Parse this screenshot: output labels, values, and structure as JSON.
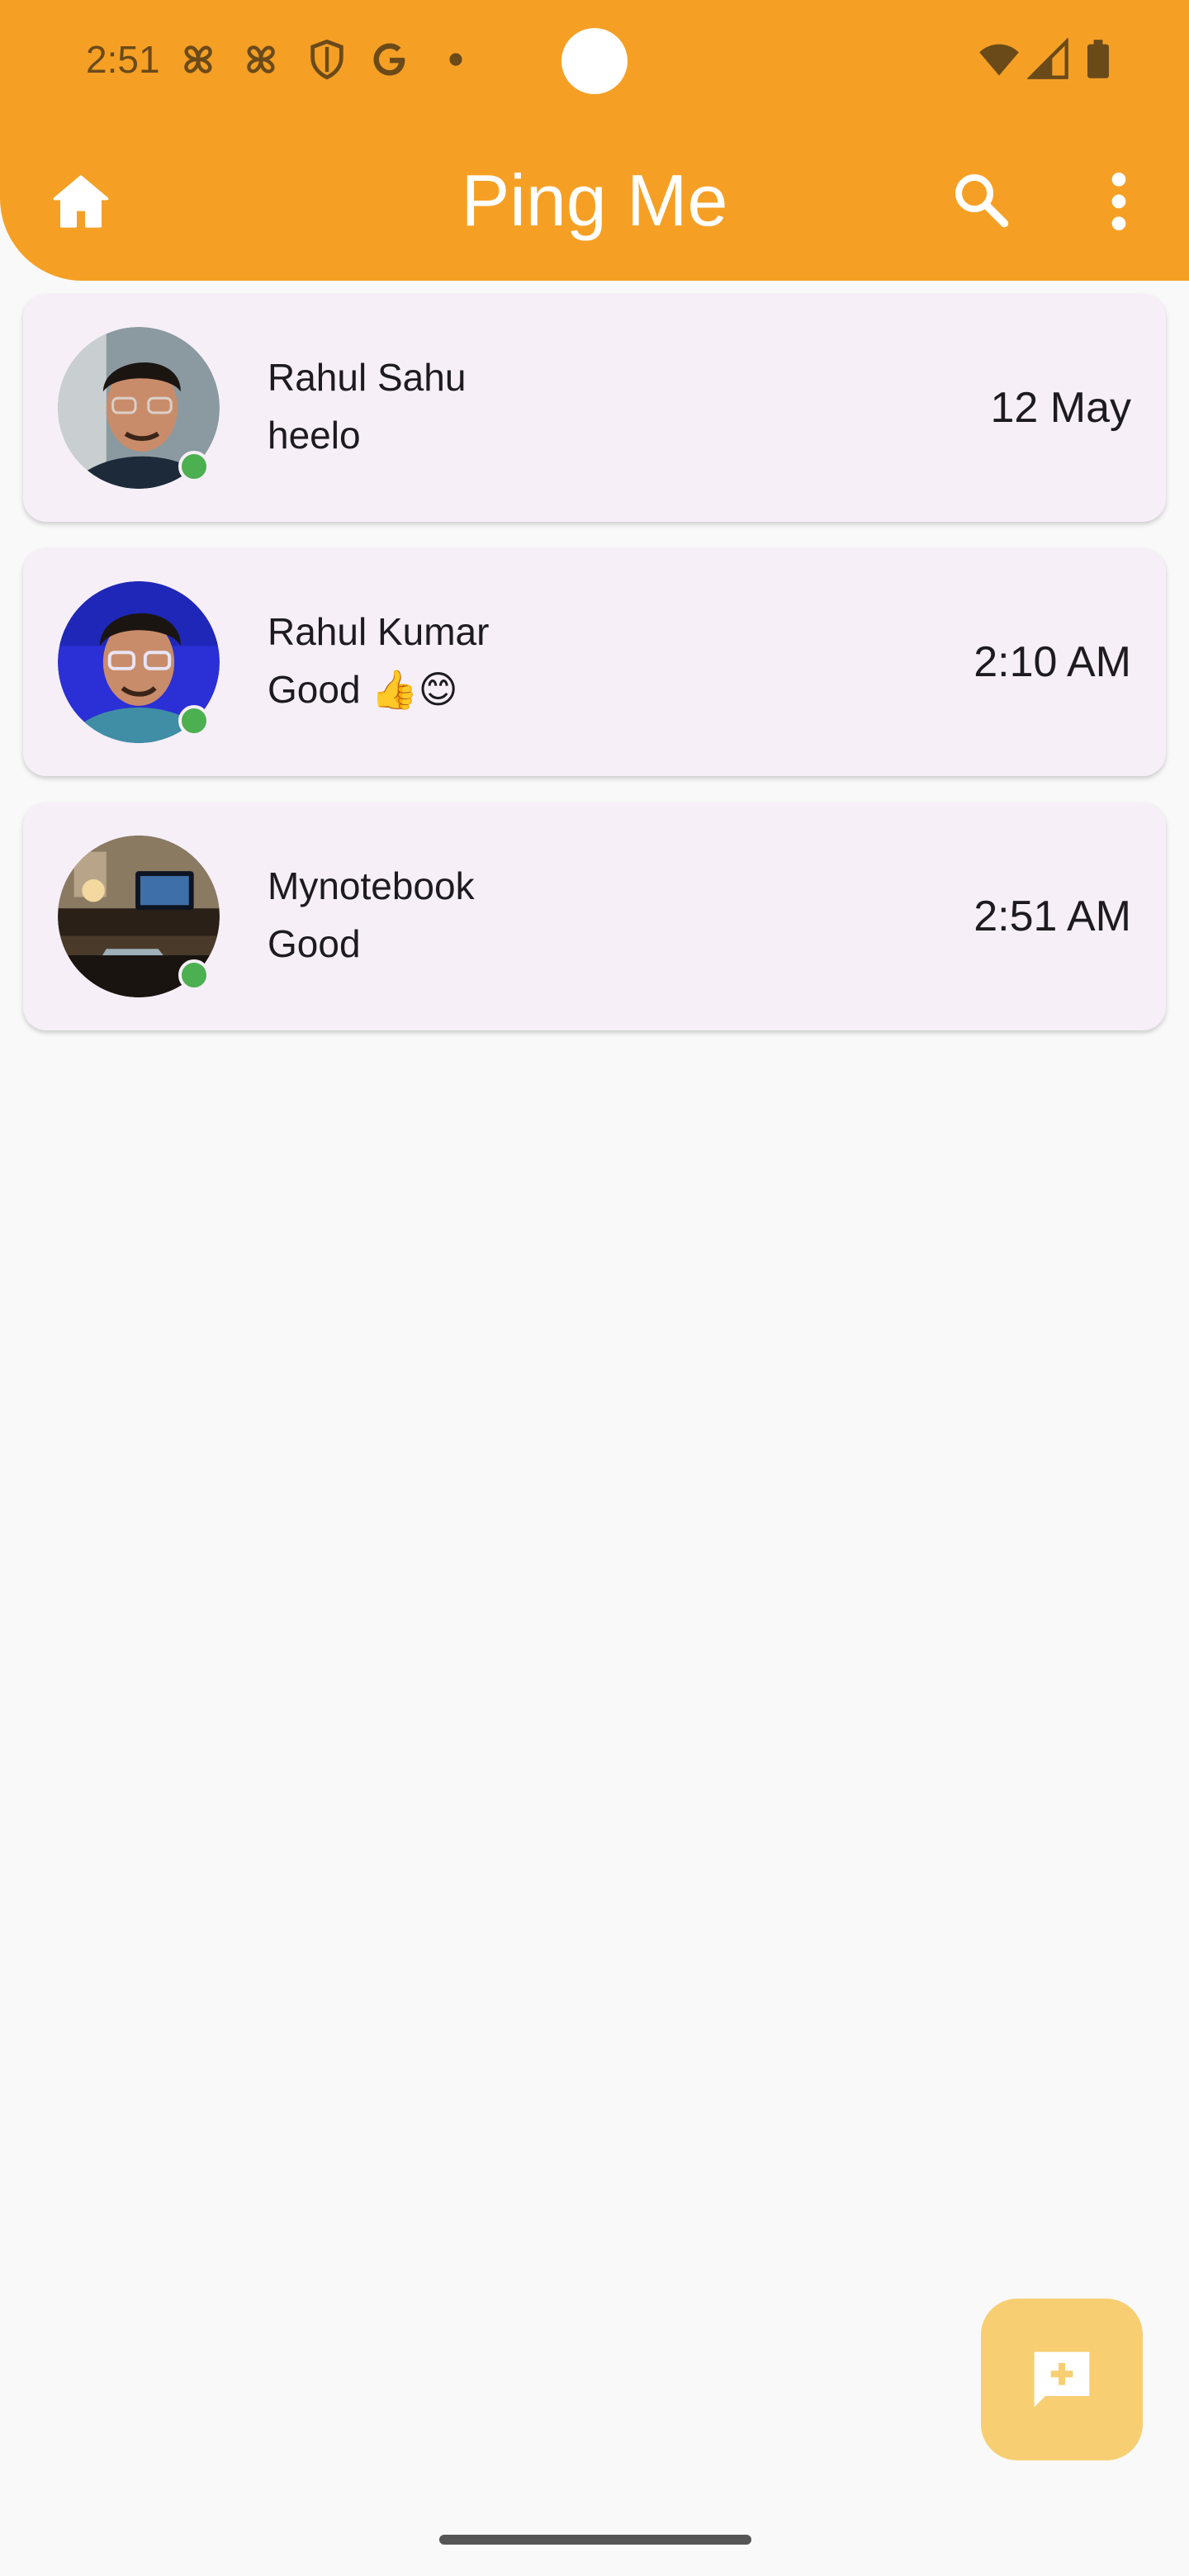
{
  "status_bar": {
    "time": "2:51",
    "icons": [
      "pinwheel-icon",
      "pinwheel-icon",
      "shield-icon",
      "google-icon",
      "dot-icon",
      "wifi-icon",
      "signal-icon",
      "battery-icon"
    ]
  },
  "appbar": {
    "title": "Ping Me",
    "color": "#f5a025",
    "icons": [
      "home-icon",
      "search-icon",
      "more-vert-icon"
    ]
  },
  "chats": [
    {
      "name": "Rahul Sahu",
      "message": "heelo",
      "time": "12 May",
      "online": true
    },
    {
      "name": "Rahul Kumar",
      "message": "Good 👍😊",
      "time": "2:10 AM",
      "online": true
    },
    {
      "name": "Mynotebook",
      "message": "Good",
      "time": "2:51 AM",
      "online": true
    }
  ],
  "fab": {
    "icon": "add-comment-icon",
    "color": "#f7cf72"
  }
}
